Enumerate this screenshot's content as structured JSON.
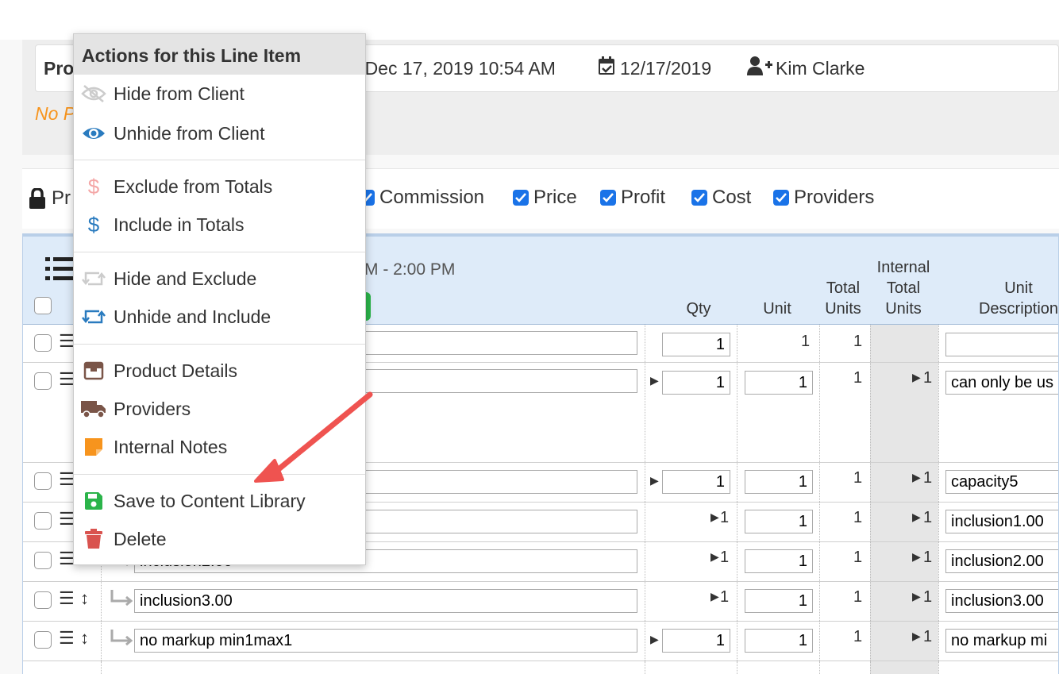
{
  "header": {
    "product_prefix": "Pro",
    "datetime": "y, Dec 17, 2019 10:54 AM",
    "date": "12/17/2019",
    "user": "Kim Clarke",
    "no_price_prefix": "No P"
  },
  "toggles": {
    "lock_prefix": "Pr",
    "items": [
      "Commission",
      "Price",
      "Profit",
      "Cost",
      "Providers"
    ]
  },
  "table": {
    "time_range": "M - 2:00 PM",
    "columns": {
      "qty": "Qty",
      "unit": "Unit",
      "total_units_1": "Total",
      "total_units_2": "Units",
      "internal_1": "Internal",
      "internal_2": "Total",
      "internal_3": "Units",
      "unit_desc_1": "Unit",
      "unit_desc_2": "Description"
    },
    "rows": [
      {
        "name": "",
        "qty": "1",
        "unit": "1",
        "total": "1",
        "internal": "",
        "desc": ""
      },
      {
        "name": "",
        "qty": "1",
        "unit": "1",
        "total": "1",
        "internal": "1",
        "desc": "can only be us"
      },
      {
        "name": "",
        "qty": "1",
        "unit": "1",
        "total": "1",
        "internal": "1",
        "desc": "capacity5"
      },
      {
        "name": "",
        "qty": "1",
        "unit": "1",
        "total": "1",
        "internal": "1",
        "desc": "inclusion1.00"
      },
      {
        "name": "inclusion2.00",
        "qty": "1",
        "unit": "1",
        "total": "1",
        "internal": "1",
        "desc": "inclusion2.00"
      },
      {
        "name": "inclusion3.00",
        "qty": "1",
        "unit": "1",
        "total": "1",
        "internal": "1",
        "desc": "inclusion3.00"
      },
      {
        "name": "no markup min1max1",
        "qty": "1",
        "unit": "1",
        "total": "1",
        "internal": "1",
        "desc": "no markup mi"
      }
    ]
  },
  "menu": {
    "title": "Actions for this Line Item",
    "items": [
      {
        "label": "Hide from Client",
        "icon": "eye-slash-icon"
      },
      {
        "label": "Unhide from Client",
        "icon": "eye-icon"
      },
      {
        "label": "Exclude from Totals",
        "icon": "dollar-icon"
      },
      {
        "label": "Include in Totals",
        "icon": "dollar-icon"
      },
      {
        "label": "Hide and Exclude",
        "icon": "retweet-icon"
      },
      {
        "label": "Unhide and Include",
        "icon": "retweet-icon"
      },
      {
        "label": "Product Details",
        "icon": "box-icon"
      },
      {
        "label": "Providers",
        "icon": "truck-icon"
      },
      {
        "label": "Internal Notes",
        "icon": "sticky-note-icon"
      },
      {
        "label": "Save to Content Library",
        "icon": "save-icon"
      },
      {
        "label": "Delete",
        "icon": "trash-icon"
      }
    ]
  },
  "colors": {
    "accent_blue": "#1a73e8",
    "icon_blue": "#2a7bbf",
    "orange": "#f7941d",
    "green": "#2bb44a",
    "red": "#d9534f",
    "arrow": "#ef5350"
  }
}
